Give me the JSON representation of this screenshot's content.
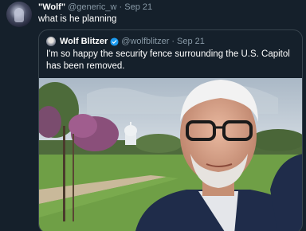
{
  "tweet": {
    "display_name": "\"Wolf\"",
    "handle": "@generic_w",
    "separator": "·",
    "date": "Sep 21",
    "text": "what is he planning"
  },
  "quoted_tweet": {
    "display_name": "Wolf Blitzer",
    "handle": "@wolfblitzer",
    "separator": "·",
    "date": "Sep 21",
    "text": "I'm so happy the security fence surrounding the U.S. Capitol has been removed.",
    "verified_icon": "verified-badge-icon",
    "photo": "selfie-photo"
  },
  "colors": {
    "background": "#15202b",
    "border": "#38444d",
    "secondary_text": "#8899a6",
    "verified": "#1d9bf0"
  }
}
